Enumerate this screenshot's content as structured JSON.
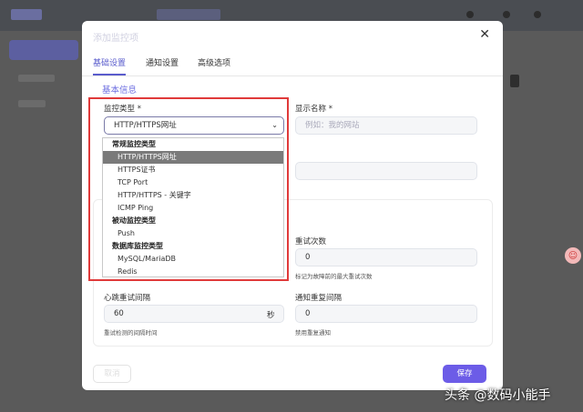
{
  "modal": {
    "title": "添加监控项",
    "close_icon": "close-icon",
    "tabs": [
      "基础设置",
      "通知设置",
      "高级选项"
    ],
    "section_title": "基本信息"
  },
  "monitor_type": {
    "label": "监控类型 *",
    "value": "HTTP/HTTPS网址",
    "options_groups": [
      {
        "group": "常规监控类型",
        "items": [
          "HTTP/HTTPS网址",
          "HTTPS证书",
          "TCP Port",
          "HTTP/HTTPS - 关键字",
          "ICMP Ping"
        ]
      },
      {
        "group": "被动监控类型",
        "items": [
          "Push"
        ]
      },
      {
        "group": "数据库监控类型",
        "items": [
          "MySQL/MariaDB",
          "Redis"
        ]
      }
    ]
  },
  "display_name": {
    "label": "显示名称 *",
    "placeholder": "例如：我的网站"
  },
  "retries": {
    "label": "重试次数",
    "value": "0",
    "hint": "标记为故障前的最大重试次数"
  },
  "heartbeat_retry": {
    "label": "心跳重试间隔",
    "value": "60",
    "unit": "秒",
    "hint": "重试检测的间隔时间"
  },
  "notify_interval": {
    "label": "通知重复间隔",
    "value": "0",
    "hint": "禁用重复通知"
  },
  "footer": {
    "cancel_label": "取消",
    "save_label": "保存"
  },
  "watermark": "头条 @数码小能手",
  "colors": {
    "accent": "#6c5ce7",
    "highlight_frame": "#e03a3a"
  }
}
